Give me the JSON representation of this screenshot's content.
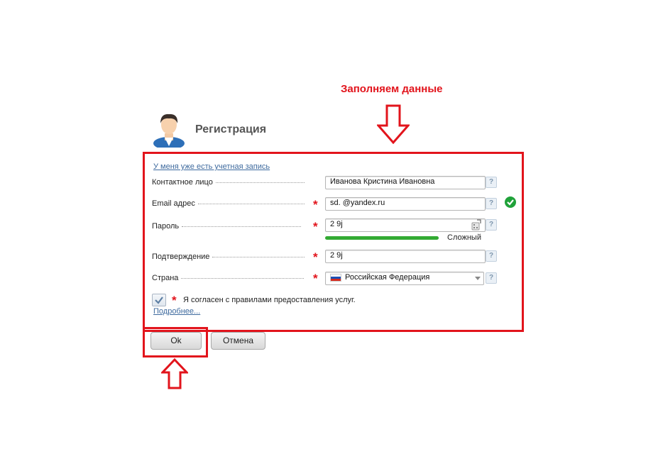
{
  "annotation": {
    "title": "Заполняем данные"
  },
  "header": {
    "title": "Регистрация",
    "avatar_icon": "user-avatar-icon"
  },
  "form": {
    "login_link": "У меня уже есть учетная запись",
    "fields": {
      "contact": {
        "label": "Контактное лицо",
        "value": "Иванова Кристина Ивановна",
        "required": false
      },
      "email": {
        "label": "Email адрес",
        "value": "sd.             @yandex.ru",
        "required": true,
        "valid": true
      },
      "password": {
        "label": "Пароль",
        "value": "2          9j",
        "required": true,
        "strength_label": "Сложный",
        "strength_fraction": 1.0
      },
      "confirm": {
        "label": "Подтверждение",
        "value": "2          9j",
        "required": true
      },
      "country": {
        "label": "Страна",
        "value": "Российская Федерация",
        "required": true,
        "flag_icon": "russia-flag-icon"
      }
    },
    "required_mark": "*",
    "help_mark": "?",
    "agree": {
      "checked": true,
      "text": "Я согласен с правилами предоставления услуг."
    },
    "more_link": "Подробнее..."
  },
  "buttons": {
    "ok": "Ok",
    "cancel": "Отмена"
  },
  "colors": {
    "accent_red": "#e2141c",
    "success_green": "#20a23a",
    "link_blue": "#3e6a9e"
  }
}
